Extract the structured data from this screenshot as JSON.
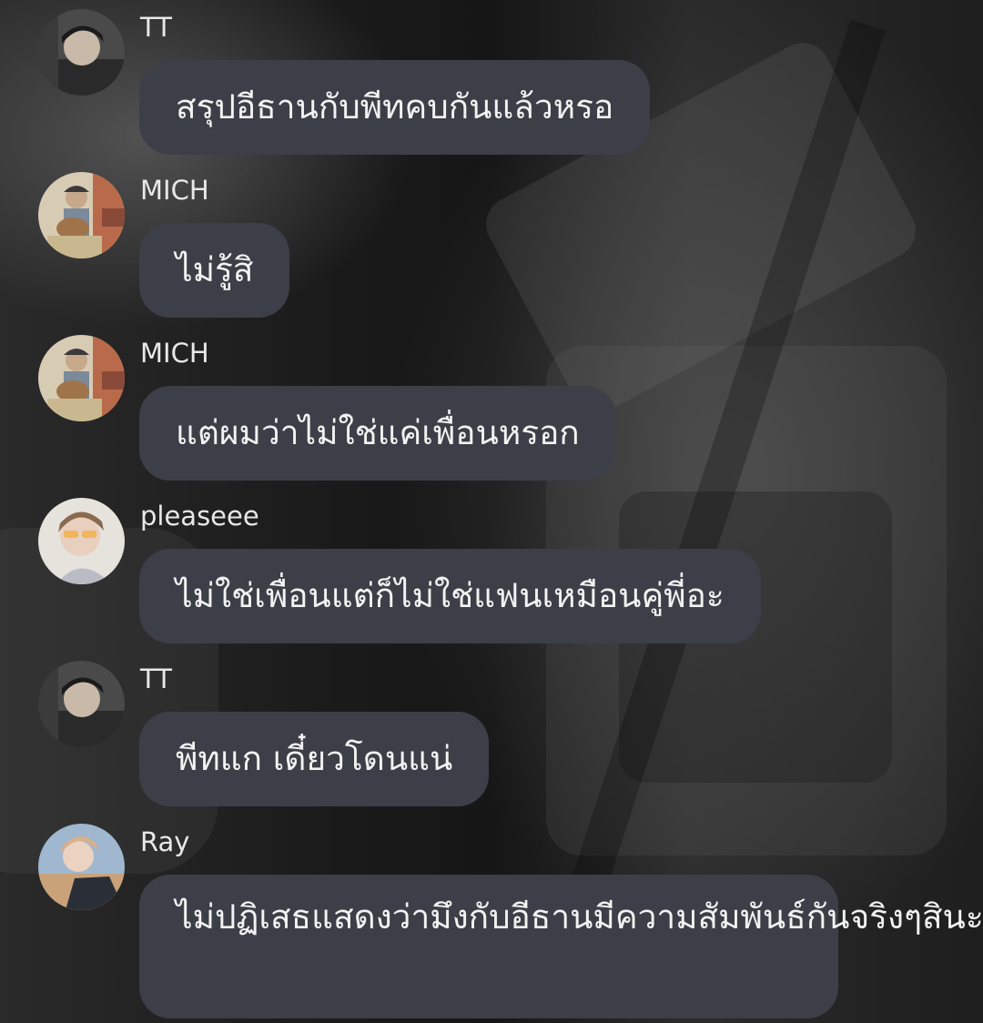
{
  "messages": [
    {
      "sender": "TT",
      "avatar": "avatar-tt-icon",
      "lines": [
        "สรุปอีธานกับพีทคบกันแล้วหรอ"
      ]
    },
    {
      "sender": "MICH",
      "avatar": "avatar-mich-icon",
      "lines": [
        "ไม่รู้สิ"
      ]
    },
    {
      "sender": "MICH",
      "avatar": "avatar-mich-icon",
      "lines": [
        "แต่ผมว่าไม่ใช่แค่เพื่อนหรอก"
      ]
    },
    {
      "sender": "pleaseee",
      "avatar": "avatar-pleaseee-icon",
      "lines": [
        "ไม่ใช่เพื่อนแต่ก็ไม่ใช่แฟนเหมือนคู่พี่อะ"
      ]
    },
    {
      "sender": "TT",
      "avatar": "avatar-tt-icon",
      "lines": [
        "พีทแก เดี๋ยวโดนแน่"
      ]
    },
    {
      "sender": "Ray",
      "avatar": "avatar-ray-icon",
      "lines": [
        "ไม่ปฏิเสธแสดงว่ามึงกับอีธานมีความ",
        "สัมพันธ์กันจริงๆสินะ"
      ]
    }
  ],
  "colors": {
    "bubble": "#3c3f47",
    "bubble_text": "#f2f2f2",
    "name_text": "#e8e8e8"
  }
}
